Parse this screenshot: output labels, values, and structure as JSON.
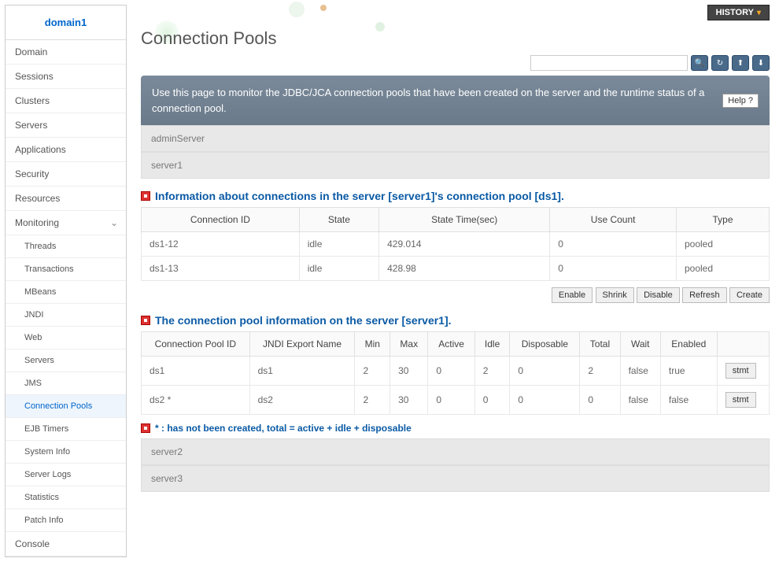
{
  "sidebar": {
    "title": "domain1",
    "items": [
      "Domain",
      "Sessions",
      "Clusters",
      "Servers",
      "Applications",
      "Security",
      "Resources",
      "Monitoring"
    ],
    "sub": [
      "Threads",
      "Transactions",
      "MBeans",
      "JNDI",
      "Web",
      "Servers",
      "JMS",
      "Connection Pools",
      "EJB Timers",
      "System Info",
      "Server Logs",
      "Statistics",
      "Patch Info"
    ],
    "console": "Console"
  },
  "history_label": "HISTORY",
  "page_title": "Connection Pools",
  "search_placeholder": "",
  "icons": {
    "search": "🔍",
    "refresh": "↻",
    "export": "⬆",
    "xml": "⬇"
  },
  "banner": "Use this page to monitor the JDBC/JCA connection pools that have been created on the server and the runtime status of a connection pool.",
  "help_label": "Help",
  "panels": {
    "admin": "adminServer",
    "server1": "server1",
    "server2": "server2",
    "server3": "server3"
  },
  "sec1": {
    "title": "Information about connections in the server [server1]'s connection pool [ds1].",
    "cols": [
      "Connection ID",
      "State",
      "State Time(sec)",
      "Use Count",
      "Type"
    ],
    "rows": [
      [
        "ds1-12",
        "idle",
        "429.014",
        "0",
        "pooled"
      ],
      [
        "ds1-13",
        "idle",
        "428.98",
        "0",
        "pooled"
      ]
    ]
  },
  "actions": [
    "Enable",
    "Shrink",
    "Disable",
    "Refresh",
    "Create"
  ],
  "sec2": {
    "title": "The connection pool information on the server [server1].",
    "cols": [
      "Connection Pool ID",
      "JNDI Export Name",
      "Min",
      "Max",
      "Active",
      "Idle",
      "Disposable",
      "Total",
      "Wait",
      "Enabled",
      ""
    ],
    "rows": [
      [
        "ds1",
        "ds1",
        "2",
        "30",
        "0",
        "2",
        "0",
        "2",
        "false",
        "true"
      ],
      [
        "ds2 *",
        "ds2",
        "2",
        "30",
        "0",
        "0",
        "0",
        "0",
        "false",
        "false"
      ]
    ],
    "stmt_label": "stmt"
  },
  "footnote": "* : has not been created, total = active + idle + disposable"
}
